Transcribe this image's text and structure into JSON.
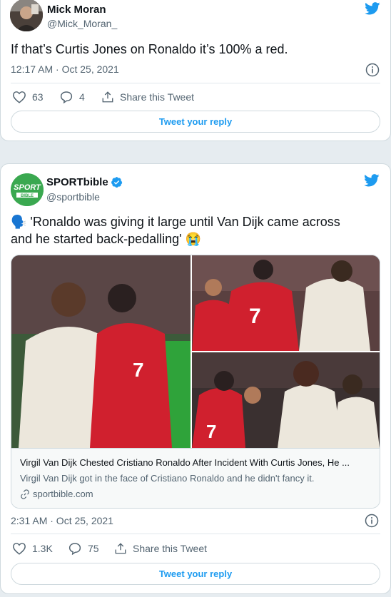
{
  "tweet1": {
    "author_name": "Mick Moran",
    "author_handle": "@Mick_Moran_",
    "text": "If that’s Curtis Jones on Ronaldo it’s 100% a red.",
    "timestamp": "12:17 AM · Oct 25, 2021",
    "likes": "63",
    "replies": "4",
    "share_label": "Share this Tweet",
    "reply_button": "Tweet your reply"
  },
  "tweet2": {
    "author_name": "SPORTbible",
    "author_handle": "@sportbible",
    "avatar_text_top": "SPORT",
    "avatar_text_bottom": "BIBLE",
    "text_line1": "🗣️ 'Ronaldo was giving it large until Van Dijk came across",
    "text_line2": "and he started back-pedalling' 😭",
    "link_card": {
      "title": "Virgil Van Dijk Chested Cristiano Ronaldo After Incident With Curtis Jones, He ...",
      "description": "Virgil Van Dijk got in the face of Cristiano Ronaldo and he didn't fancy it.",
      "domain": "sportbible.com"
    },
    "timestamp": "2:31 AM · Oct 25, 2021",
    "likes": "1.3K",
    "replies": "75",
    "share_label": "Share this Tweet",
    "reply_button": "Tweet your reply"
  },
  "colors": {
    "twitter_blue": "#1d9bf0",
    "verified_blue": "#1d9bf0",
    "sportbible_green": "#3aa850",
    "man_utd_red": "#d0202e",
    "liverpool_kit": "#ece7dc"
  },
  "icons": {
    "bird": "twitter-bird-icon",
    "info": "info-icon",
    "like": "heart-icon",
    "reply": "comment-icon",
    "share": "share-icon",
    "link": "link-icon",
    "verified": "verified-badge-icon"
  }
}
